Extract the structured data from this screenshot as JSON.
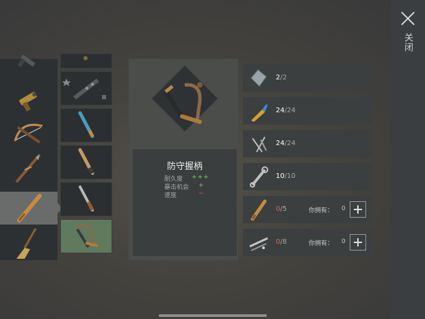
{
  "close": {
    "label": "关闭",
    "icon": "close-icon"
  },
  "weapons_col1": [
    {
      "icon": "pistol-icon",
      "selected": false
    },
    {
      "icon": "flare-gun-icon",
      "selected": false
    },
    {
      "icon": "crossbow-icon",
      "selected": false
    },
    {
      "icon": "spear-icon",
      "selected": false
    },
    {
      "icon": "baseball-bat-icon",
      "selected": true
    },
    {
      "icon": "broom-icon",
      "selected": false
    }
  ],
  "weapons_col2": [
    {
      "icon": "partial-item-icon",
      "selected": false
    },
    {
      "icon": "spiked-club-icon",
      "selected": false,
      "locked": true
    },
    {
      "icon": "blue-handle-icon",
      "selected": false
    },
    {
      "icon": "wooden-handle-icon",
      "selected": false
    },
    {
      "icon": "metal-handle-icon",
      "selected": false
    },
    {
      "icon": "guard-grip-icon",
      "selected": true
    }
  ],
  "item": {
    "name": "防守握柄",
    "stats": [
      {
        "label": "耐久度",
        "value": "+++",
        "kind": "plus"
      },
      {
        "label": "暴击机会",
        "value": "+",
        "kind": "plus"
      },
      {
        "label": "速度",
        "value": "−",
        "kind": "minus"
      }
    ]
  },
  "materials": [
    {
      "icon": "metal-sheet-icon",
      "have": "2",
      "total": "/2",
      "short": false
    },
    {
      "icon": "glue-icon",
      "have": "24",
      "total": "/24",
      "short": false
    },
    {
      "icon": "nails-icon",
      "have": "24",
      "total": "/24",
      "short": false
    },
    {
      "icon": "wrench-icon",
      "have": "10",
      "total": "/10",
      "short": false
    },
    {
      "icon": "baseball-bat-icon",
      "have": "0",
      "total": "/5",
      "short": true,
      "own_label": "你拥有：",
      "own_value": "0"
    },
    {
      "icon": "pipe-parts-icon",
      "have": "0",
      "total": "/8",
      "short": true,
      "own_label": "你拥有：",
      "own_value": "0"
    }
  ],
  "colors": {
    "plus": "#77d06a",
    "minus": "#d55a4c",
    "selected_slot": "#5f7a5d"
  }
}
